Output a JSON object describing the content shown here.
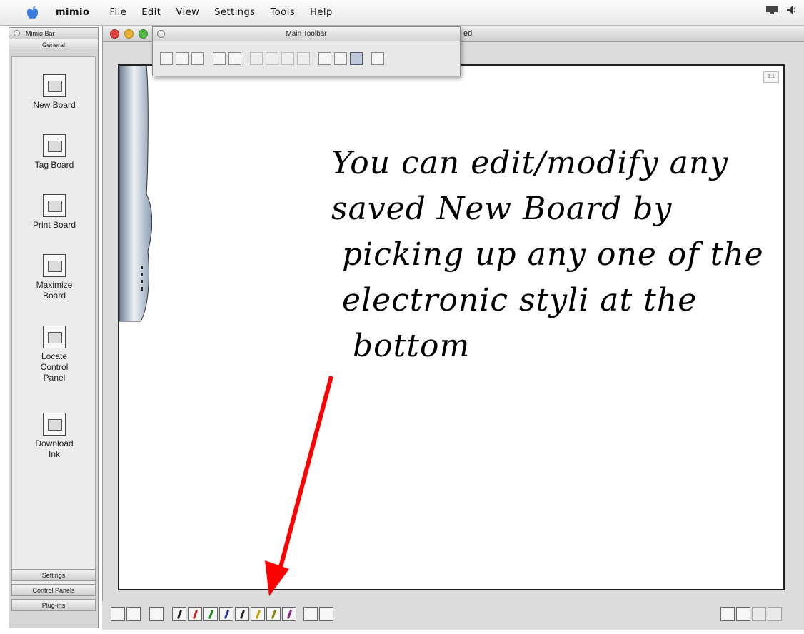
{
  "menubar": {
    "app_name": "mimio",
    "items": [
      "File",
      "Edit",
      "View",
      "Settings",
      "Tools",
      "Help"
    ]
  },
  "mimio_bar": {
    "title": "Mimio Bar",
    "tab_general": "General",
    "items": [
      {
        "label": "New Board",
        "icon": "new-board-icon"
      },
      {
        "label": "Tag Board",
        "icon": "tag-board-icon"
      },
      {
        "label": "Print Board",
        "icon": "print-board-icon"
      },
      {
        "label": "Maximize\nBoard",
        "icon": "maximize-board-icon"
      },
      {
        "label": "Locate\nControl\nPanel",
        "icon": "locate-control-panel-icon"
      },
      {
        "label": "Download\nInk",
        "icon": "download-ink-icon"
      }
    ],
    "bottom_tabs": [
      "Settings",
      "Control Panels",
      "Plug-ins"
    ]
  },
  "window": {
    "title_suffix": "ed"
  },
  "main_toolbar": {
    "title": "Main Toolbar",
    "buttons": [
      "new-icon",
      "open-icon",
      "save-icon",
      "print-icon",
      "print-preview-icon",
      "cut-icon",
      "copy-icon",
      "paste-icon",
      "delete-icon",
      "zoom-in-icon",
      "zoom-out-icon",
      "zoom-fit-icon",
      "present-icon"
    ]
  },
  "canvas": {
    "handwriting": "You can edit/modify any\nsaved New Board by\n picking up any one of the\n electronic styli at the\n  bottom",
    "arrow_color": "#ff0000"
  },
  "bottom_tools": {
    "pen_colors": [
      "#222222",
      "#cc2222",
      "#228822",
      "#2233aa",
      "#222222",
      "#c9a000",
      "#888800",
      "#882288"
    ]
  }
}
